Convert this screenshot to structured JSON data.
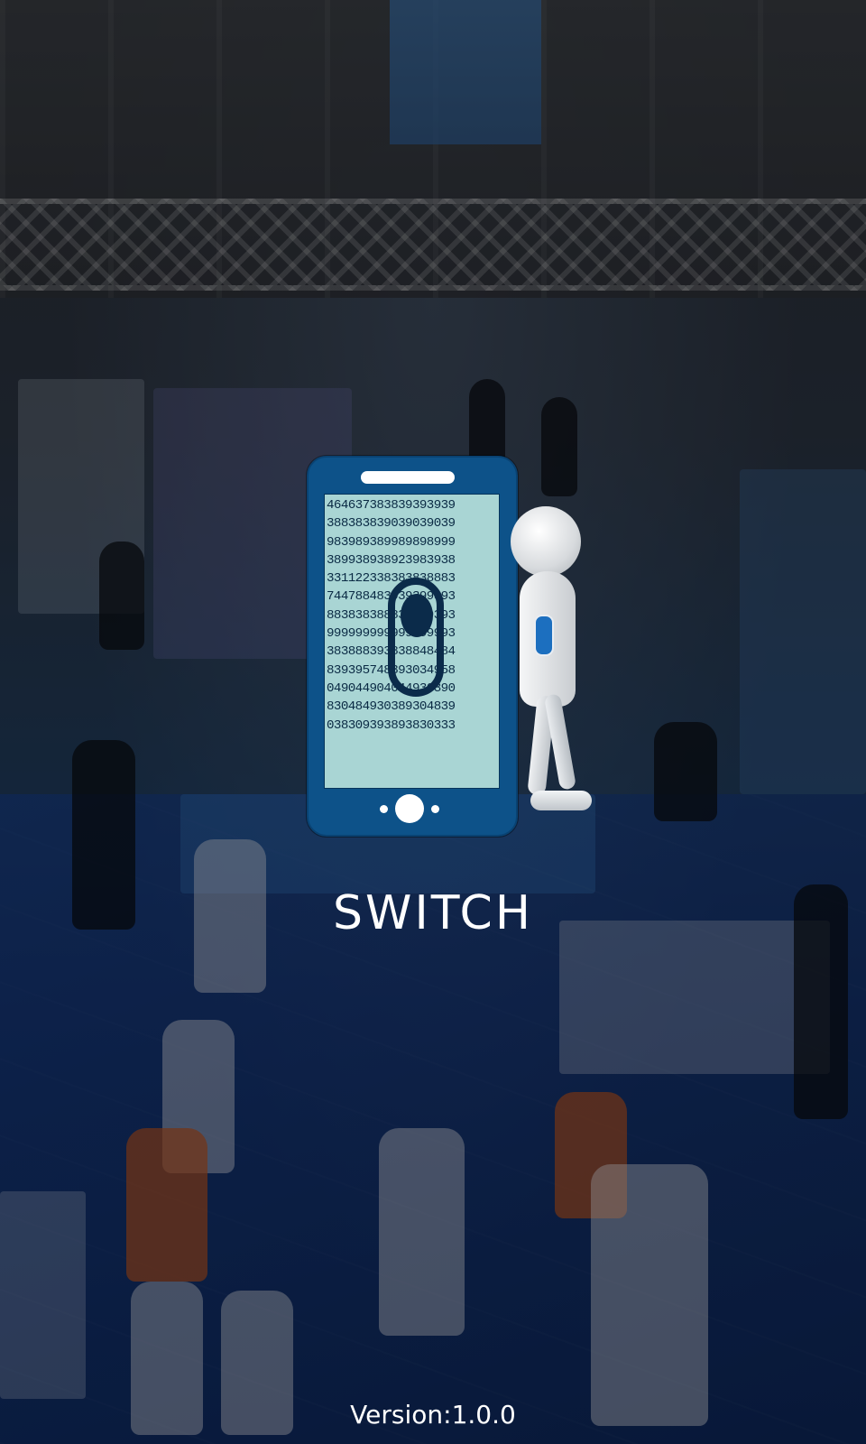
{
  "app": {
    "name": "SWITCH",
    "version_text": "Version:1.0.0"
  },
  "logo": {
    "screen_digits": [
      "464637383839393939",
      "388383839039039039",
      "983989389989898999",
      "389938938923983938",
      "331122338383838883",
      "744788483939399393",
      "883838388833399393",
      "999999999999999993",
      "383888393838848484",
      "839395748393034958",
      "049044904044930390",
      "830484930389304839",
      "038309393893830333"
    ],
    "icons": [
      "phone-icon",
      "toggle-switch-icon",
      "mascot-figure"
    ]
  },
  "colors": {
    "phone_body": "#0d5289",
    "phone_screen": "#a9d5d4",
    "switch": "#0b2b4a",
    "text": "#ffffff"
  }
}
